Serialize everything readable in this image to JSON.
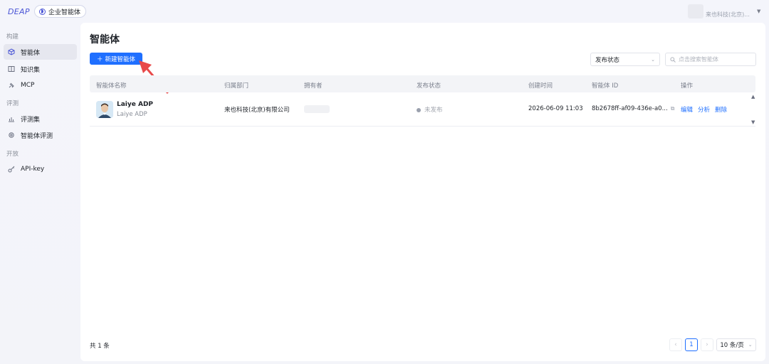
{
  "header": {
    "logo": "DEAP",
    "app_name": "企业智能体",
    "user_name": "来也科技(北京)..."
  },
  "sidebar": {
    "sections": [
      {
        "title": "构建",
        "items": [
          {
            "label": "智能体",
            "icon": "cube-icon",
            "active": true
          },
          {
            "label": "知识集",
            "icon": "book-icon"
          },
          {
            "label": "MCP",
            "icon": "plug-icon"
          }
        ]
      },
      {
        "title": "评测",
        "items": [
          {
            "label": "评测集",
            "icon": "bar-chart-icon"
          },
          {
            "label": "智能体评测",
            "icon": "gear-icon"
          }
        ]
      },
      {
        "title": "开放",
        "items": [
          {
            "label": "API-key",
            "icon": "key-icon"
          }
        ]
      }
    ]
  },
  "main": {
    "title": "智能体",
    "new_button": "新建智能体",
    "status_filter": "发布状态",
    "search_placeholder": "点击搜索智能体"
  },
  "table": {
    "columns": [
      "智能体名称",
      "归属部门",
      "拥有者",
      "发布状态",
      "创建时间",
      "智能体 ID",
      "操作"
    ],
    "rows": [
      {
        "name": "Laiye ADP",
        "subtitle": "Laiye ADP",
        "department": "来也科技(北京)有限公司",
        "owner": "",
        "status": "未发布",
        "created": "2026-06-09 11:03",
        "agent_id": "8b2678ff-af09-436e-a0...",
        "actions": [
          "编辑",
          "分析",
          "删除"
        ]
      }
    ]
  },
  "footer": {
    "total": "共 1 条",
    "current_page": "1",
    "page_size": "10 条/页"
  },
  "colors": {
    "accent": "#1f6fff",
    "brand": "#4a55d6",
    "arrow": "#e84a4a"
  }
}
